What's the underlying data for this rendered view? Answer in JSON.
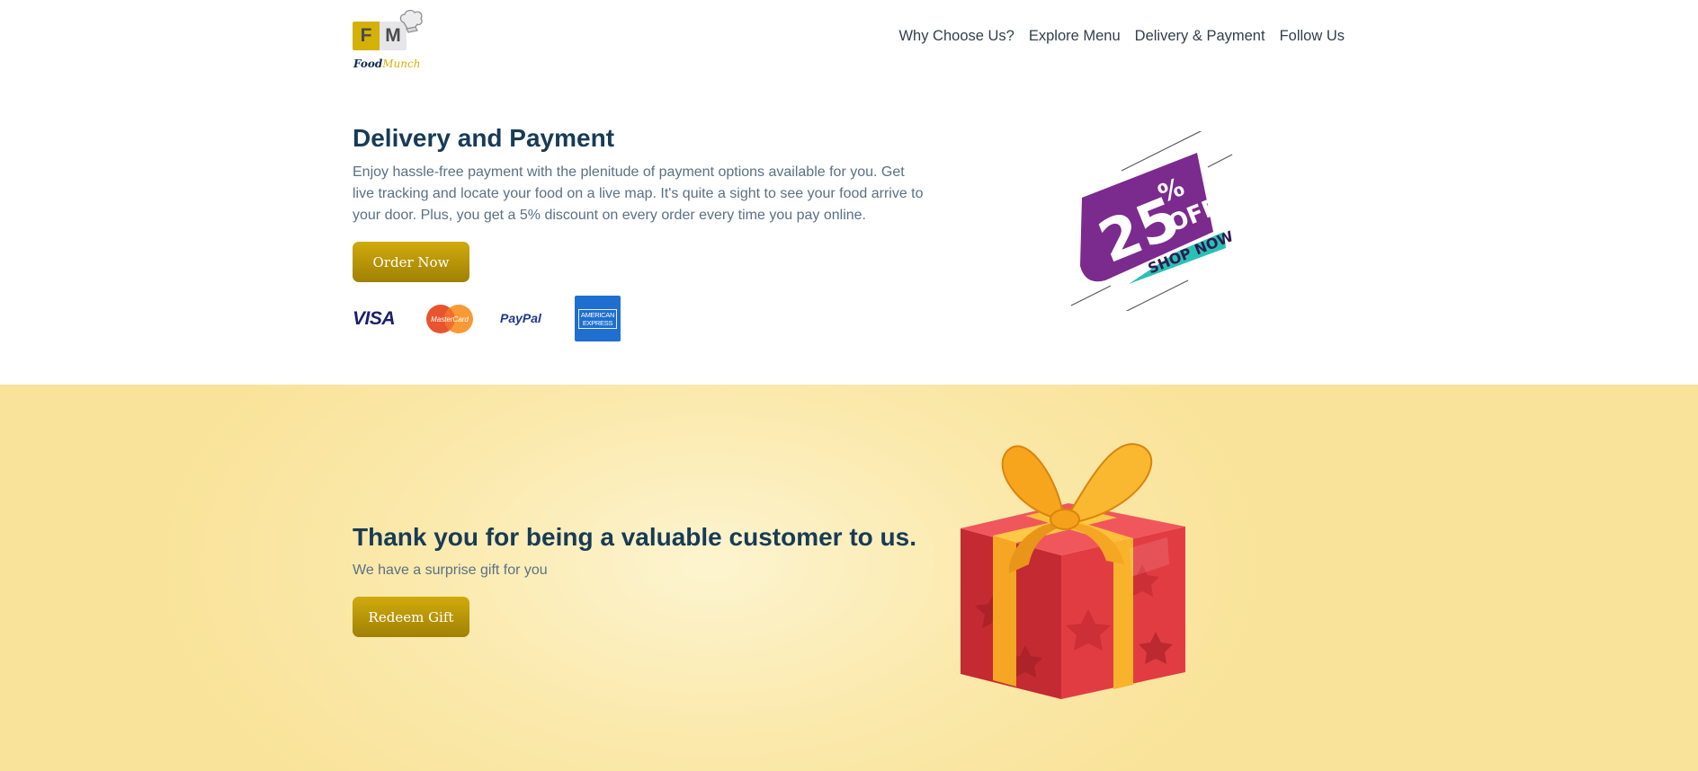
{
  "brand": {
    "logo_letters": [
      "F",
      "M"
    ],
    "logo_text_first": "Food",
    "logo_text_second": "Munch",
    "colors": {
      "accent": "#d4b106",
      "heading": "#183b56",
      "body_text": "#5a7184"
    }
  },
  "nav": {
    "links": [
      {
        "label": "Why Choose Us?"
      },
      {
        "label": "Explore Menu"
      },
      {
        "label": "Delivery & Payment"
      },
      {
        "label": "Follow Us"
      }
    ]
  },
  "delivery": {
    "title": "Delivery and Payment",
    "description": "Enjoy hassle-free payment with the plenitude of payment options available for you. Get live tracking and locate your food on a live map. It's quite a sight to see your food arrive to your door. Plus, you get a 5% discount on every order every time you pay online.",
    "order_button": "Order Now",
    "payment_methods": {
      "visa": "VISA",
      "mastercard": "MasterCard",
      "paypal": "PayPal",
      "amex_line1": "AMERICAN",
      "amex_line2": "EXPRESS"
    },
    "badge": {
      "percent": "25",
      "percent_sign": "%",
      "off": "OFF",
      "shop_now": "SHOP NOW"
    }
  },
  "gift": {
    "title": "Thank you for being a valuable customer to us.",
    "subtitle": "We have a surprise gift for you",
    "redeem_button": "Redeem Gift"
  }
}
